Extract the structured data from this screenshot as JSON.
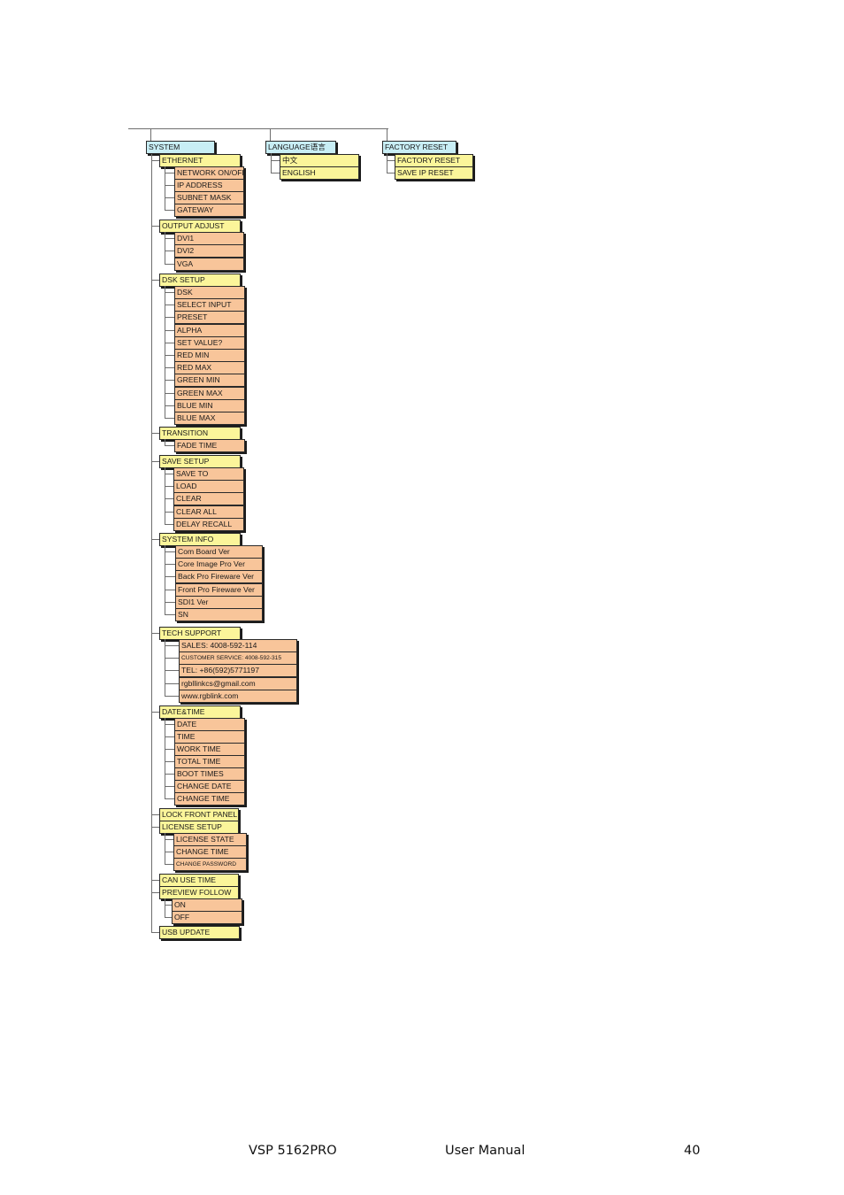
{
  "menu_tree": {
    "roots": [
      {
        "label": "SYSTEM",
        "children": [
          {
            "label": "ETHERNET",
            "children": [
              "NETWORK ON/OFF",
              "IP ADDRESS",
              "SUBNET MASK",
              "GATEWAY"
            ]
          },
          {
            "label": "OUTPUT ADJUST",
            "children": [
              "DVI1",
              "DVI2",
              "VGA"
            ]
          },
          {
            "label": "DSK SETUP",
            "children": [
              "DSK",
              "SELECT INPUT",
              "PRESET",
              "ALPHA",
              "SET VALUE?",
              "RED MIN",
              "RED MAX",
              "GREEN MIN",
              "GREEN MAX",
              "BLUE MIN",
              "BLUE MAX"
            ]
          },
          {
            "label": "TRANSITION",
            "children": [
              "FADE TIME"
            ]
          },
          {
            "label": "SAVE SETUP",
            "children": [
              "SAVE TO",
              "LOAD",
              "CLEAR",
              "CLEAR ALL",
              "DELAY RECALL"
            ]
          },
          {
            "label": "SYSTEM INFO",
            "children": [
              "Com Board Ver",
              "Core Image Pro Ver",
              "Back Pro Fireware Ver",
              "Front Pro Fireware Ver",
              "SDI1 Ver",
              "SN"
            ]
          },
          {
            "label": "TECH SUPPORT",
            "children": [
              "SALES: 4008-592-114",
              "CUSTOMER SERVICE: 4008-592-315",
              "TEL: +86(592)5771197",
              "rgbllinkcs@gmail.com",
              "www.rgblink.com"
            ]
          },
          {
            "label": "DATE&TIME",
            "children": [
              "DATE",
              "TIME",
              "WORK TIME",
              "TOTAL TIME",
              "BOOT TIMES",
              "CHANGE DATE",
              "CHANGE TIME"
            ]
          },
          {
            "label": "LOCK FRONT PANEL",
            "children": []
          },
          {
            "label": "LICENSE SETUP",
            "children": [
              "LICENSE STATE",
              "CHANGE TIME",
              "CHANGE PASSWORD"
            ]
          },
          {
            "label": "CAN USE TIME",
            "children": []
          },
          {
            "label": "PREVIEW FOLLOW",
            "children": [
              "ON",
              "OFF"
            ]
          },
          {
            "label": "USB UPDATE",
            "children": []
          }
        ]
      },
      {
        "label": "LANGUAGE语言",
        "children": [
          {
            "label": "中文",
            "children": []
          },
          {
            "label": "ENGLISH",
            "children": []
          }
        ]
      },
      {
        "label": "FACTORY RESET",
        "children": [
          {
            "label": "FACTORY RESET",
            "children": []
          },
          {
            "label": "SAVE IP RESET",
            "children": []
          }
        ]
      }
    ]
  },
  "colors": {
    "root": "#c8eef5",
    "level1": "#fbf59a",
    "level2": "#f8c59a"
  },
  "footer": {
    "product": "VSP 5162PRO",
    "title": "User Manual",
    "page_number": "40"
  }
}
